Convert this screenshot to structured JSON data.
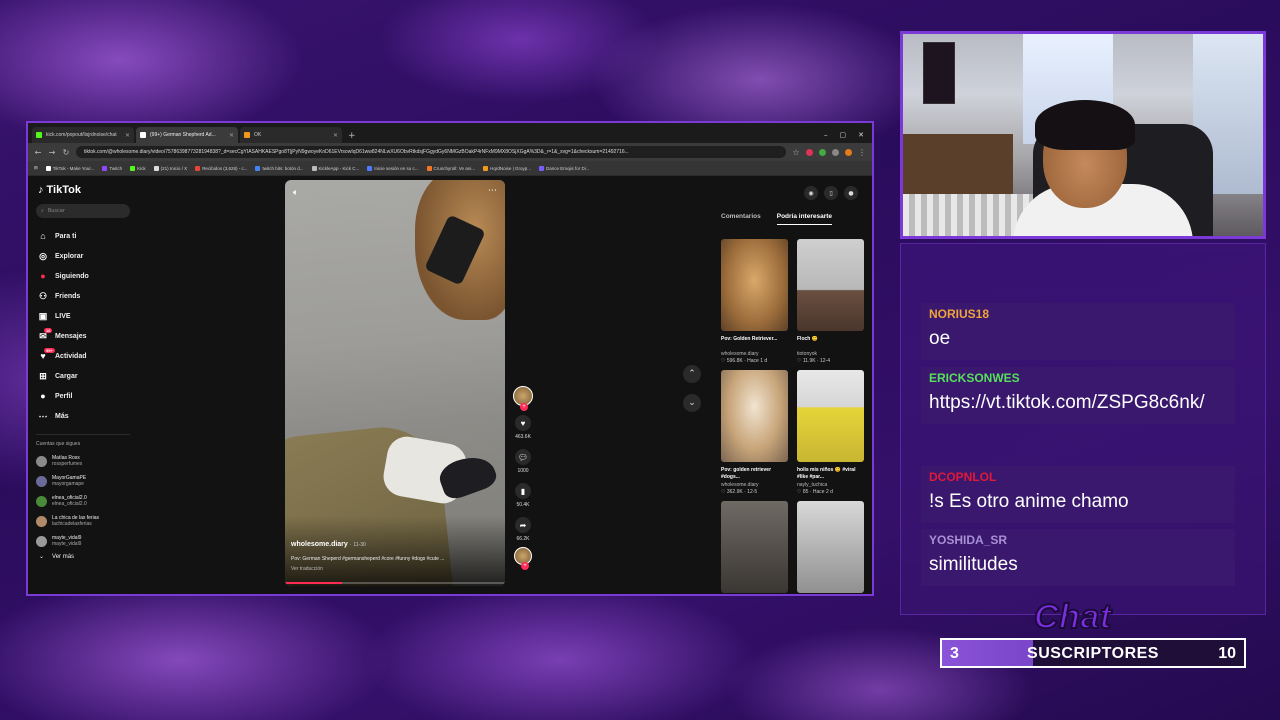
{
  "browser": {
    "tabs": [
      {
        "label": "kick.com/popout/lisjrdnoise/chat",
        "color": "#53fc18"
      },
      {
        "label": "(99+) German Shepherd Ad...",
        "color": "#ffffff"
      },
      {
        "label": "OK",
        "color": "#f29a1e"
      }
    ],
    "new_tab": "+",
    "controls": [
      "–",
      "▢",
      "✕"
    ],
    "url": "tiktok.com/@wholesome.diary/video/7578639877328194838?_d=secCgYIASAHKAESPgo8T|jPyN9gwoyeKnD61EVrsowIqD61ww824NLwXU6ObvRtkdsjFGgydGy6NMGzBOakP4rNFxM9MX8OSjXGgA%3D&_r=1&_svg=1&checksum=21492716...",
    "bookmarks": [
      {
        "label": "TikTok - Make Your...",
        "color": "#ffffff"
      },
      {
        "label": "Twitch",
        "color": "#9146ff"
      },
      {
        "label": "Kick",
        "color": "#53fc18"
      },
      {
        "label": "(21) Inicio / X",
        "color": "#dddddd"
      },
      {
        "label": "Recibidos (3,628) - c...",
        "color": "#ea4335"
      },
      {
        "label": "twitch bits: botón d...",
        "color": "#4285f4"
      },
      {
        "label": "KickleApp - Kick C...",
        "color": "#bbbbbb"
      },
      {
        "label": "Inicie sesión en su c...",
        "color": "#4f7cff"
      },
      {
        "label": "Crunchyroll: Ve ani...",
        "color": "#f47521"
      },
      {
        "label": "HqrdNoise | Groyp...",
        "color": "#f29a1e"
      },
      {
        "label": "Dance Emojis for Di...",
        "color": "#7b5cff"
      }
    ]
  },
  "tiktok": {
    "logo": "TikTok",
    "search_placeholder": "Buscar",
    "nav": [
      {
        "label": "Para ti",
        "icon": "home-icon",
        "glyph": "⌂"
      },
      {
        "label": "Explorar",
        "icon": "compass-icon",
        "glyph": "◎"
      },
      {
        "label": "Siguiendo",
        "icon": "following-avatar-icon",
        "glyph": "●"
      },
      {
        "label": "Friends",
        "icon": "friends-icon",
        "glyph": "⚇"
      },
      {
        "label": "LIVE",
        "icon": "live-icon",
        "glyph": "▣"
      },
      {
        "label": "Mensajes",
        "icon": "messages-icon",
        "glyph": "✉",
        "badge": "16"
      },
      {
        "label": "Actividad",
        "icon": "activity-icon",
        "glyph": "♥",
        "badge": "99+"
      },
      {
        "label": "Cargar",
        "icon": "upload-icon",
        "glyph": "⊞"
      },
      {
        "label": "Perfil",
        "icon": "profile-icon",
        "glyph": "●"
      },
      {
        "label": "Más",
        "icon": "more-icon",
        "glyph": "⋯"
      }
    ],
    "following_header": "Cuentas que sigues",
    "following": [
      {
        "name": "Matías Ross",
        "handle": "rossperfumes"
      },
      {
        "name": "MayorGamaPE",
        "handle": "mayorgamape"
      },
      {
        "name": "elnea_oficial2.0",
        "handle": "elnea_oficial2.0"
      },
      {
        "name": "La chica de las ferias",
        "handle": "lachicadelasferias"
      },
      {
        "name": "mayte_vidal9",
        "handle": "mayte_vidal9"
      }
    ],
    "see_more": "Ver más",
    "video": {
      "user": "wholesome.diary",
      "date": "11-30",
      "description": "Pov: German Sheperd #germansheperd #core #funny #dogs #cute ...",
      "translate": "Ver traducción",
      "progress": 0.26
    },
    "actions": {
      "likes": "463.6K",
      "comments": "1000",
      "saves": "50.4K",
      "shares": "66.2K"
    },
    "panel_tabs": [
      "Comentarios",
      "Podría interesarte"
    ],
    "cards": [
      {
        "title": "Pov: Golden Retriever...",
        "user": "wholesome.diary",
        "stats": "♡ 596.8K · Hace 1 d",
        "thumb": "th1"
      },
      {
        "title": "Floch 😊",
        "user": "tiotonyok",
        "stats": "♡ 11.9K · 12-4",
        "thumb": "th2"
      },
      {
        "title": "Pov: golden retriever #dogs...",
        "user": "wholesome.diary",
        "stats": "♡ 362.9K · 12-5",
        "thumb": "th3"
      },
      {
        "title": "holis mis niños 😊 #viral #like #par...",
        "user": "nayly_tuchica",
        "stats": "♡ 85 · Hace 2 d",
        "thumb": "th4"
      },
      {
        "title": "",
        "user": "",
        "stats": "",
        "thumb": "th5"
      },
      {
        "title": "",
        "user": "",
        "stats": "",
        "thumb": "th6"
      }
    ]
  },
  "chat": {
    "messages": [
      {
        "user": "NORIUS18",
        "color": "#f0a43a",
        "text": "oe"
      },
      {
        "user": "ERICKSONWES",
        "color": "#56e05a",
        "text": "https://vt.tiktok.com/ZSPG8c6nk/"
      },
      {
        "user": "DCOPNLOL",
        "color": "#e0183a",
        "text": "!s Es otro anime chamo"
      },
      {
        "user": "YOSHIDA_SR",
        "color": "#a88fd6",
        "text": "similitudes"
      }
    ],
    "title": "Chat"
  },
  "subgoal": {
    "current": "3",
    "label": "SUSCRIPTORES",
    "goal": "10",
    "progress": 0.3
  },
  "colors": {
    "accent": "#7b3ad6",
    "tiktok_red": "#fe2c55"
  }
}
